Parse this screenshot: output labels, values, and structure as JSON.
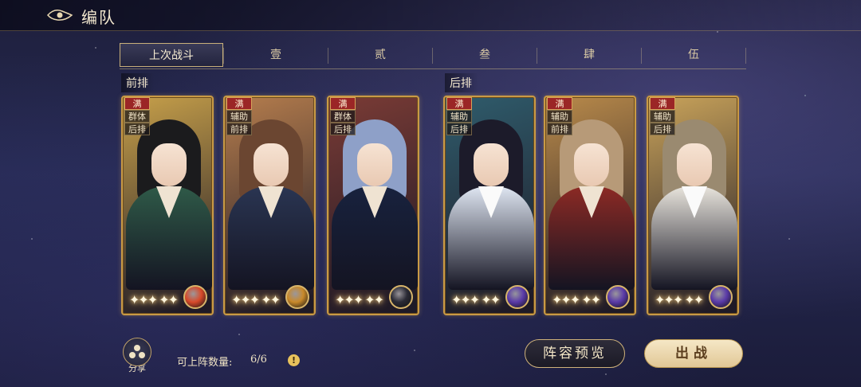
{
  "header": {
    "title": "编队"
  },
  "tabs": [
    {
      "label": "上次战斗",
      "active": true
    },
    {
      "label": "壹"
    },
    {
      "label": "贰"
    },
    {
      "label": "叁"
    },
    {
      "label": "肆"
    },
    {
      "label": "伍"
    }
  ],
  "sections": {
    "front": "前排",
    "back": "后排"
  },
  "cards": [
    {
      "badge": "满",
      "role": "群体",
      "position": "后排",
      "bg": "#c7a04a",
      "robe": "#2f5a48",
      "hair": "#1b1b1d",
      "orb_color": "#d84a2a",
      "orb_icon": "sun-orb-icon",
      "sparkles": "✦✦✦ ✦✦"
    },
    {
      "badge": "满",
      "role": "辅助",
      "position": "前排",
      "bg": "#b57d4d",
      "robe": "#2a3552",
      "hair": "#6b4631",
      "orb_color": "#c9892a",
      "orb_icon": "sun-orb-icon",
      "sparkles": "✦✦✦ ✦✦"
    },
    {
      "badge": "满",
      "role": "群体",
      "position": "后排",
      "bg": "#7a3b35",
      "robe": "#18223e",
      "hair": "#8ea0c8",
      "orb_color": "#2a2a35",
      "orb_icon": "eye-orb-icon",
      "sparkles": "✦✦✦ ✦✦"
    },
    {
      "badge": "满",
      "role": "辅助",
      "position": "后排",
      "bg": "#2f5c6c",
      "robe": "#dfe6f2",
      "hair": "#1c1b2a",
      "orb_color": "#5a3aa8",
      "orb_icon": "star-orb-icon",
      "sparkles": "✦✦✦ ✦✦"
    },
    {
      "badge": "满",
      "role": "辅助",
      "position": "前排",
      "bg": "#b98a4a",
      "robe": "#8c2a24",
      "hair": "#b79a78",
      "orb_color": "#5a3aa8",
      "orb_icon": "star-orb-icon",
      "sparkles": "✦✦✦ ✦✦"
    },
    {
      "badge": "满",
      "role": "辅助",
      "position": "后排",
      "bg": "#c9a35a",
      "robe": "#e8e4dc",
      "hair": "#9a8a70",
      "orb_color": "#5a3aa8",
      "orb_icon": "star-orb-icon",
      "sparkles": "✦✦✦ ✦✦"
    }
  ],
  "footer": {
    "share_label": "分享",
    "count_label": "可上阵数量:",
    "count_value": "6/6",
    "info_icon": "!",
    "preview_label": "阵容预览",
    "battle_label": "出战"
  }
}
